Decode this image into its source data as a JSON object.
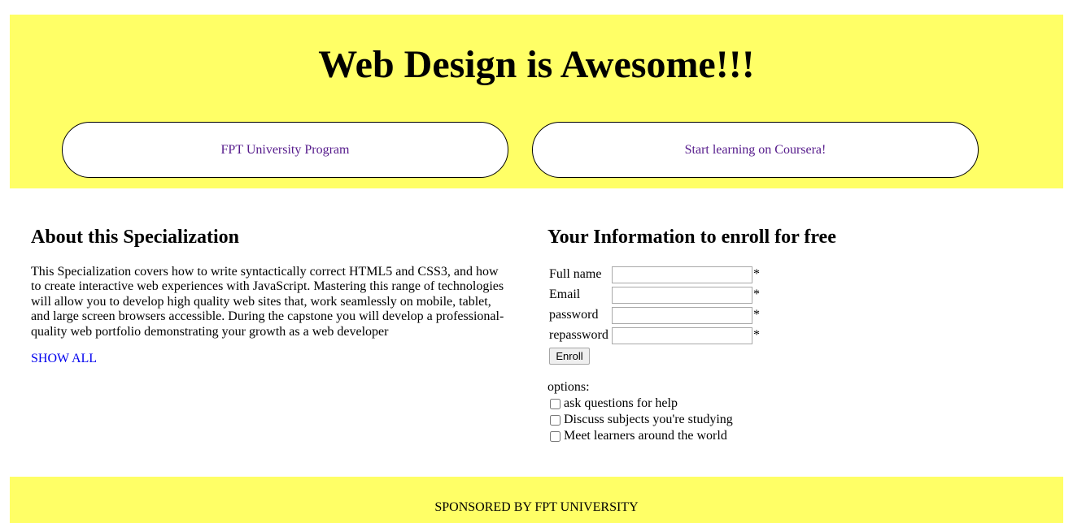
{
  "header": {
    "title": "Web Design is Awesome!!!",
    "links": [
      "FPT University Program",
      "Start learning on Coursera!"
    ]
  },
  "about": {
    "heading": "About this Specialization",
    "text": "This Specialization covers how to write syntactically correct HTML5 and CSS3, and how to create interactive web experiences with JavaScript. Mastering this range of technologies will allow you to develop high quality web sites that, work seamlessly on mobile, tablet, and large screen browsers accessible. During the capstone you will develop a professional-quality web portfolio demonstrating your growth as a web developer",
    "show_all": "SHOW ALL"
  },
  "enroll": {
    "heading": "Your Information to enroll for free",
    "fields": [
      {
        "label": "Full name",
        "value": "",
        "required_mark": "*"
      },
      {
        "label": "Email",
        "value": "",
        "required_mark": "*"
      },
      {
        "label": "password",
        "value": "",
        "required_mark": "*"
      },
      {
        "label": "repassword",
        "value": "",
        "required_mark": "*"
      }
    ],
    "submit_label": "Enroll",
    "options_label": "options:",
    "options": [
      {
        "label": "ask questions for help",
        "checked": false
      },
      {
        "label": "Discuss subjects you're studying",
        "checked": false
      },
      {
        "label": "Meet learners around the world",
        "checked": false
      }
    ]
  },
  "footer": {
    "text": "SPONSORED BY FPT UNIVERSITY"
  },
  "colors": {
    "banner_bg": "#ffff66",
    "visited_link": "#551a8b",
    "link": "#0000ee"
  }
}
